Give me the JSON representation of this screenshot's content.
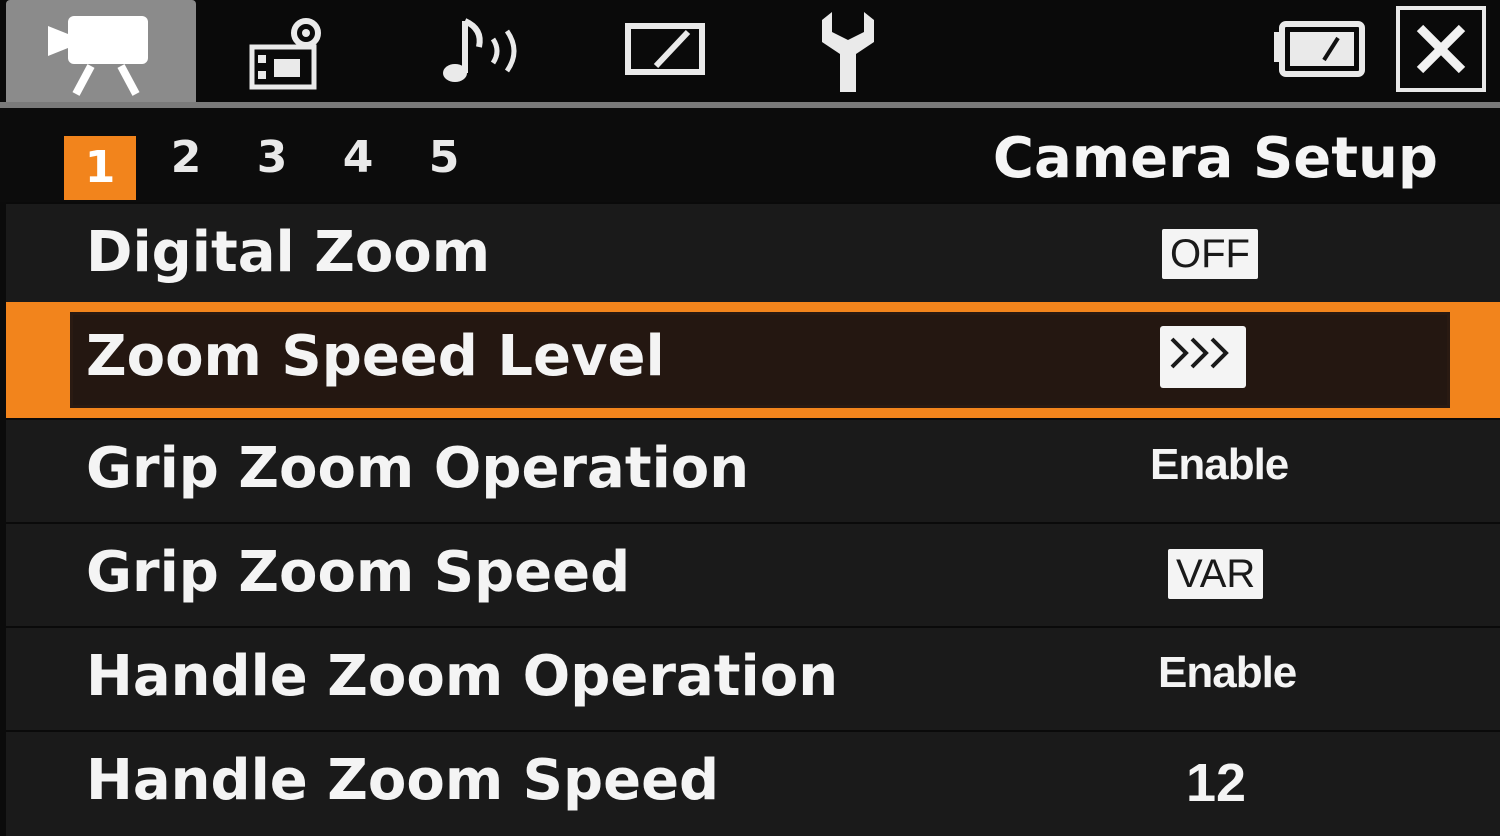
{
  "header": {
    "tabs": [
      {
        "icon": "video-camera-icon",
        "active": true
      },
      {
        "icon": "camera-settings-icon",
        "active": false
      },
      {
        "icon": "audio-icon",
        "active": false
      },
      {
        "icon": "display-icon",
        "active": false
      },
      {
        "icon": "wrench-icon",
        "active": false
      }
    ],
    "battery_icon": "battery-icon",
    "close_icon": "close-icon"
  },
  "pages": {
    "numbers": [
      "1",
      "2",
      "3",
      "4",
      "5"
    ],
    "active": "1",
    "title": "Camera Setup"
  },
  "menu": {
    "items": [
      {
        "label": "Digital Zoom",
        "value": "OFF",
        "style": "boxed"
      },
      {
        "label": "Zoom Speed Level",
        "value": ">>>",
        "style": "chevrons",
        "selected": true
      },
      {
        "label": "Grip Zoom Operation",
        "value": "Enable",
        "style": "plain"
      },
      {
        "label": "Grip Zoom Speed",
        "value": "VAR",
        "style": "boxed"
      },
      {
        "label": "Handle Zoom Operation",
        "value": "Enable",
        "style": "plain"
      },
      {
        "label": "Handle Zoom Speed",
        "value": "12",
        "style": "plain"
      }
    ]
  },
  "colors": {
    "accent": "#f2841c",
    "row_bg": "#1a1a1a",
    "active_tab_bg": "#8b8b8b"
  }
}
